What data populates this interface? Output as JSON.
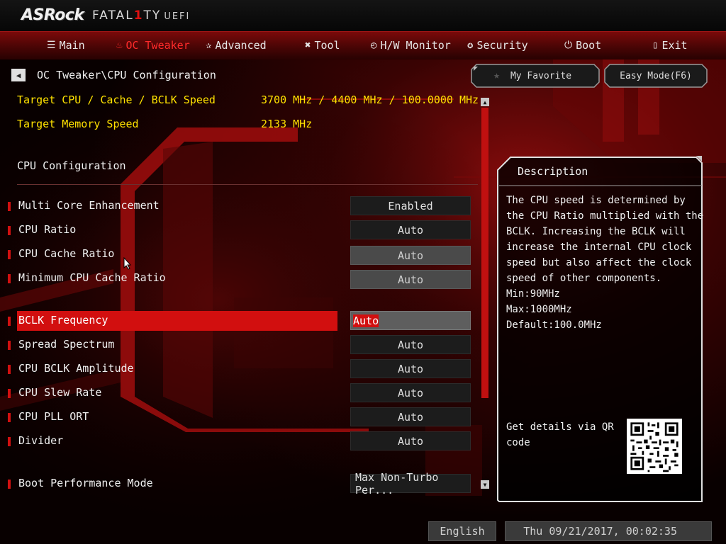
{
  "brand": {
    "name": "ASRock",
    "series": "FATAL",
    "one": "1",
    "series_tail": "TY",
    "uefi": "UEFI"
  },
  "nav": {
    "tabs": [
      {
        "label": "Main",
        "icon": "list-icon"
      },
      {
        "label": "OC Tweaker",
        "icon": "flame-icon",
        "active": true
      },
      {
        "label": "Advanced",
        "icon": "star-icon"
      },
      {
        "label": "Tool",
        "icon": "tools-icon"
      },
      {
        "label": "H/W Monitor",
        "icon": "monitor-gauge-icon"
      },
      {
        "label": "Security",
        "icon": "shield-icon"
      },
      {
        "label": "Boot",
        "icon": "power-icon"
      },
      {
        "label": "Exit",
        "icon": "exit-door-icon"
      }
    ]
  },
  "breadcrumb": {
    "path": "OC Tweaker\\CPU Configuration"
  },
  "buttons": {
    "favorite": "My Favorite",
    "easy_mode": "Easy Mode(F6)"
  },
  "info": {
    "target_cpu_label": "Target CPU / Cache / BCLK Speed",
    "target_cpu_value": "3700 MHz / 4400 MHz / 100.0000 MHz",
    "target_mem_label": "Target Memory Speed",
    "target_mem_value": "2133 MHz"
  },
  "section_title": "CPU Configuration",
  "settings": [
    {
      "label": "Multi Core Enhancement",
      "value": "Enabled"
    },
    {
      "label": "CPU Ratio",
      "value": "Auto"
    },
    {
      "label": "CPU Cache Ratio",
      "value": "Auto",
      "disabled": true
    },
    {
      "label": "Minimum CPU Cache Ratio",
      "value": "Auto",
      "disabled": true
    },
    {
      "label": "BCLK Frequency",
      "value": "Auto",
      "selected": true
    },
    {
      "label": "Spread Spectrum",
      "value": "Auto"
    },
    {
      "label": "CPU BCLK Amplitude",
      "value": "Auto"
    },
    {
      "label": "CPU Slew Rate",
      "value": "Auto"
    },
    {
      "label": "CPU PLL ORT",
      "value": "Auto"
    },
    {
      "label": "Divider",
      "value": "Auto"
    },
    {
      "label": "Boot Performance Mode",
      "value": "Max Non-Turbo Per..."
    }
  ],
  "description": {
    "title": "Description",
    "lines": [
      "The CPU speed is determined by",
      "the CPU Ratio multiplied with the",
      "BCLK. Increasing the BCLK will",
      "increase the internal CPU clock",
      "speed but also affect the clock",
      "speed of other components.",
      "Min:90MHz",
      "Max:1000MHz",
      "Default:100.0MHz"
    ],
    "qr_line1": "Get details via QR",
    "qr_line2": "code"
  },
  "footer": {
    "language": "English",
    "datetime": "Thu 09/21/2017, 00:02:35"
  },
  "colors": {
    "accent": "#d20f0f",
    "info_yellow": "#ffe100"
  }
}
